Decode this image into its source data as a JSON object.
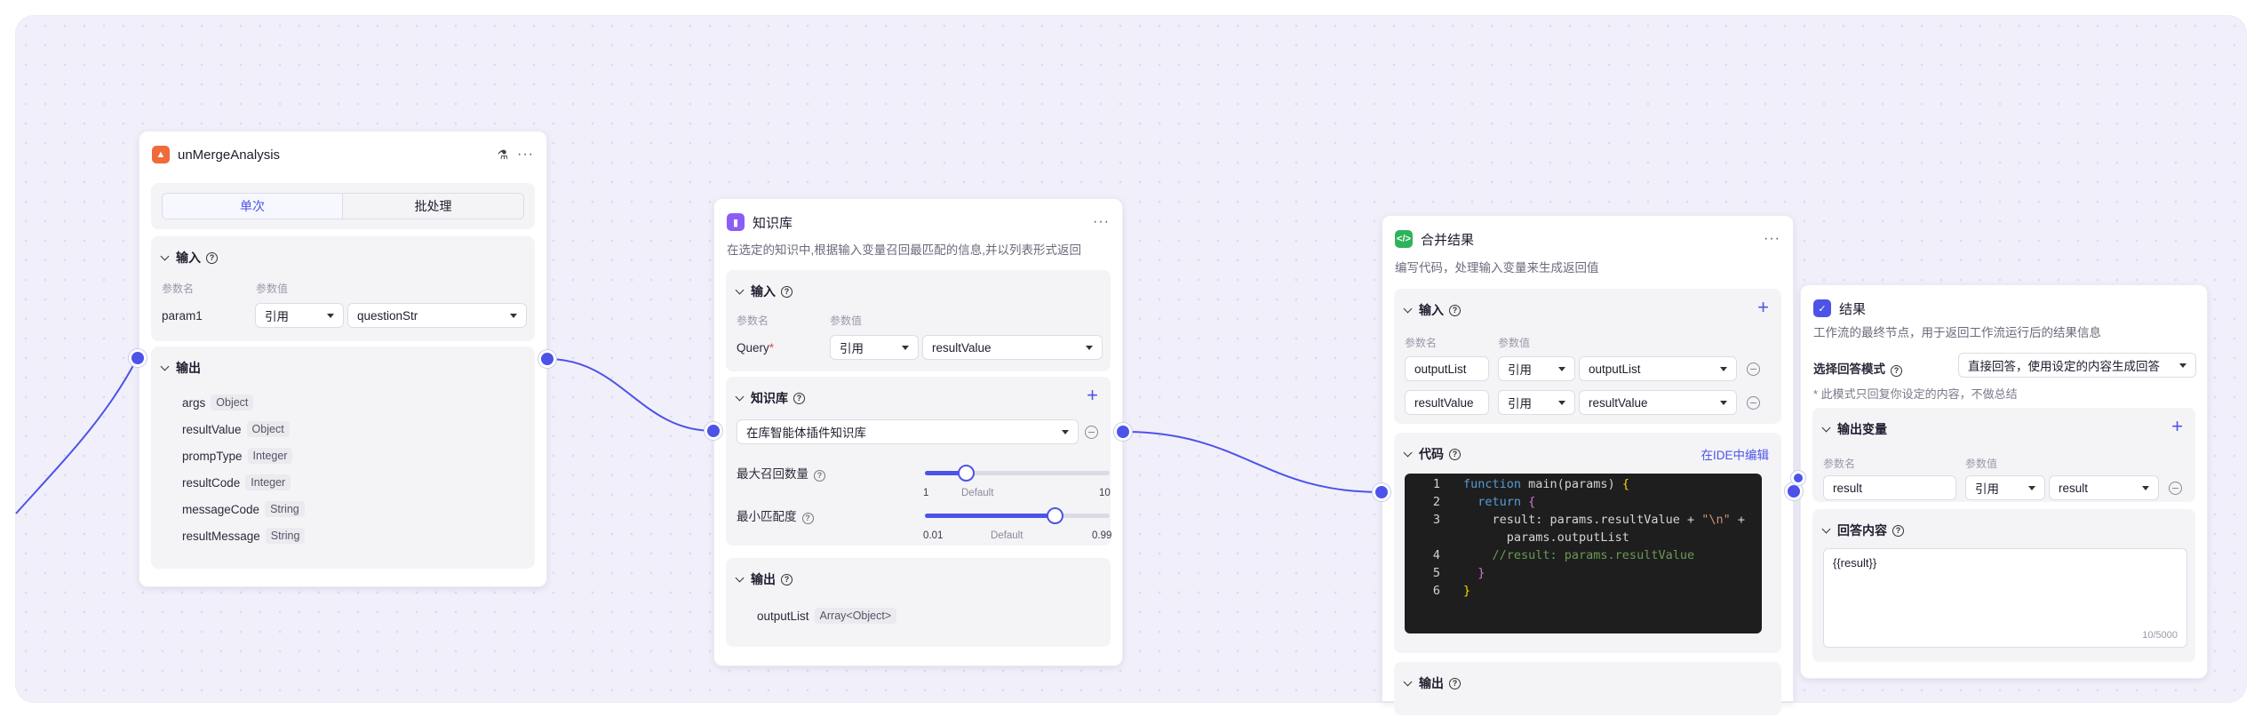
{
  "colors": {
    "accent": "#4d53e8",
    "node_icon_orange": "#f06a3a",
    "node_icon_purple": "#8b5cf6",
    "node_icon_green": "#2fb35a",
    "node_icon_blue": "#4d53e8"
  },
  "node1": {
    "title": "unMergeAnalysis",
    "icon": "plugin-icon",
    "tabs": [
      "单次",
      "批处理"
    ],
    "active_tab": "单次",
    "input": {
      "title": "输入",
      "col_name": "参数名",
      "col_value": "参数值",
      "row": {
        "name": "param1",
        "mode": "引用",
        "value": "questionStr"
      }
    },
    "output": {
      "title": "输出",
      "fields": [
        {
          "name": "args",
          "type": "Object"
        },
        {
          "name": "resultValue",
          "type": "Object"
        },
        {
          "name": "prompType",
          "type": "Integer"
        },
        {
          "name": "resultCode",
          "type": "Integer"
        },
        {
          "name": "messageCode",
          "type": "String"
        },
        {
          "name": "resultMessage",
          "type": "String"
        }
      ]
    }
  },
  "node2": {
    "title": "知识库",
    "icon": "knowledge-icon",
    "desc": "在选定的知识中,根据输入变量召回最匹配的信息,并以列表形式返回",
    "input": {
      "title": "输入",
      "col_name": "参数名",
      "col_value": "参数值",
      "row": {
        "name": "Query",
        "required": "*",
        "mode": "引用",
        "value": "resultValue"
      }
    },
    "kb": {
      "title": "知识库",
      "selected": "在库智能体插件知识库",
      "max_recall_label": "最大召回数量",
      "max_recall": {
        "min": "1",
        "default": "Default",
        "max": "10",
        "value": 3,
        "range": [
          1,
          10
        ]
      },
      "min_match_label": "最小匹配度",
      "min_match": {
        "min": "0.01",
        "default": "Default",
        "max": "0.99",
        "value": 0.7,
        "range": [
          0.01,
          0.99
        ]
      }
    },
    "output": {
      "title": "输出",
      "fields": [
        {
          "name": "outputList",
          "type": "Array<Object>"
        }
      ]
    }
  },
  "node3": {
    "title": "合并结果",
    "icon": "code-icon",
    "desc": "编写代码，处理输入变量来生成返回值",
    "input": {
      "title": "输入",
      "col_name": "参数名",
      "col_value": "参数值",
      "rows": [
        {
          "name": "outputList",
          "mode": "引用",
          "value": "outputList"
        },
        {
          "name": "resultValue",
          "mode": "引用",
          "value": "resultValue"
        }
      ]
    },
    "code": {
      "title": "代码",
      "ide_link": "在IDE中编辑",
      "line_numbers": [
        "1",
        "2",
        "3",
        "",
        "4",
        "5",
        "6"
      ],
      "lines": [
        "function main(params) {",
        "  return {",
        "    result: params.resultValue + \"\\n\" +",
        "      params.outputList",
        "    //result: params.resultValue",
        "  }",
        "}"
      ]
    },
    "output": {
      "title": "输出"
    }
  },
  "node4": {
    "title": "结果",
    "icon": "end-check-icon",
    "desc": "工作流的最终节点，用于返回工作流运行后的结果信息",
    "mode_label": "选择回答模式",
    "mode_value": "直接回答，使用设定的内容生成回答",
    "note": "* 此模式只回复你设定的内容，不做总结",
    "output_vars": {
      "title": "输出变量",
      "col_name": "参数名",
      "col_value": "参数值",
      "row": {
        "name": "result",
        "mode": "引用",
        "value": "result"
      }
    },
    "answer": {
      "title": "回答内容",
      "value": "{{result}}",
      "counter": "10/5000"
    }
  }
}
